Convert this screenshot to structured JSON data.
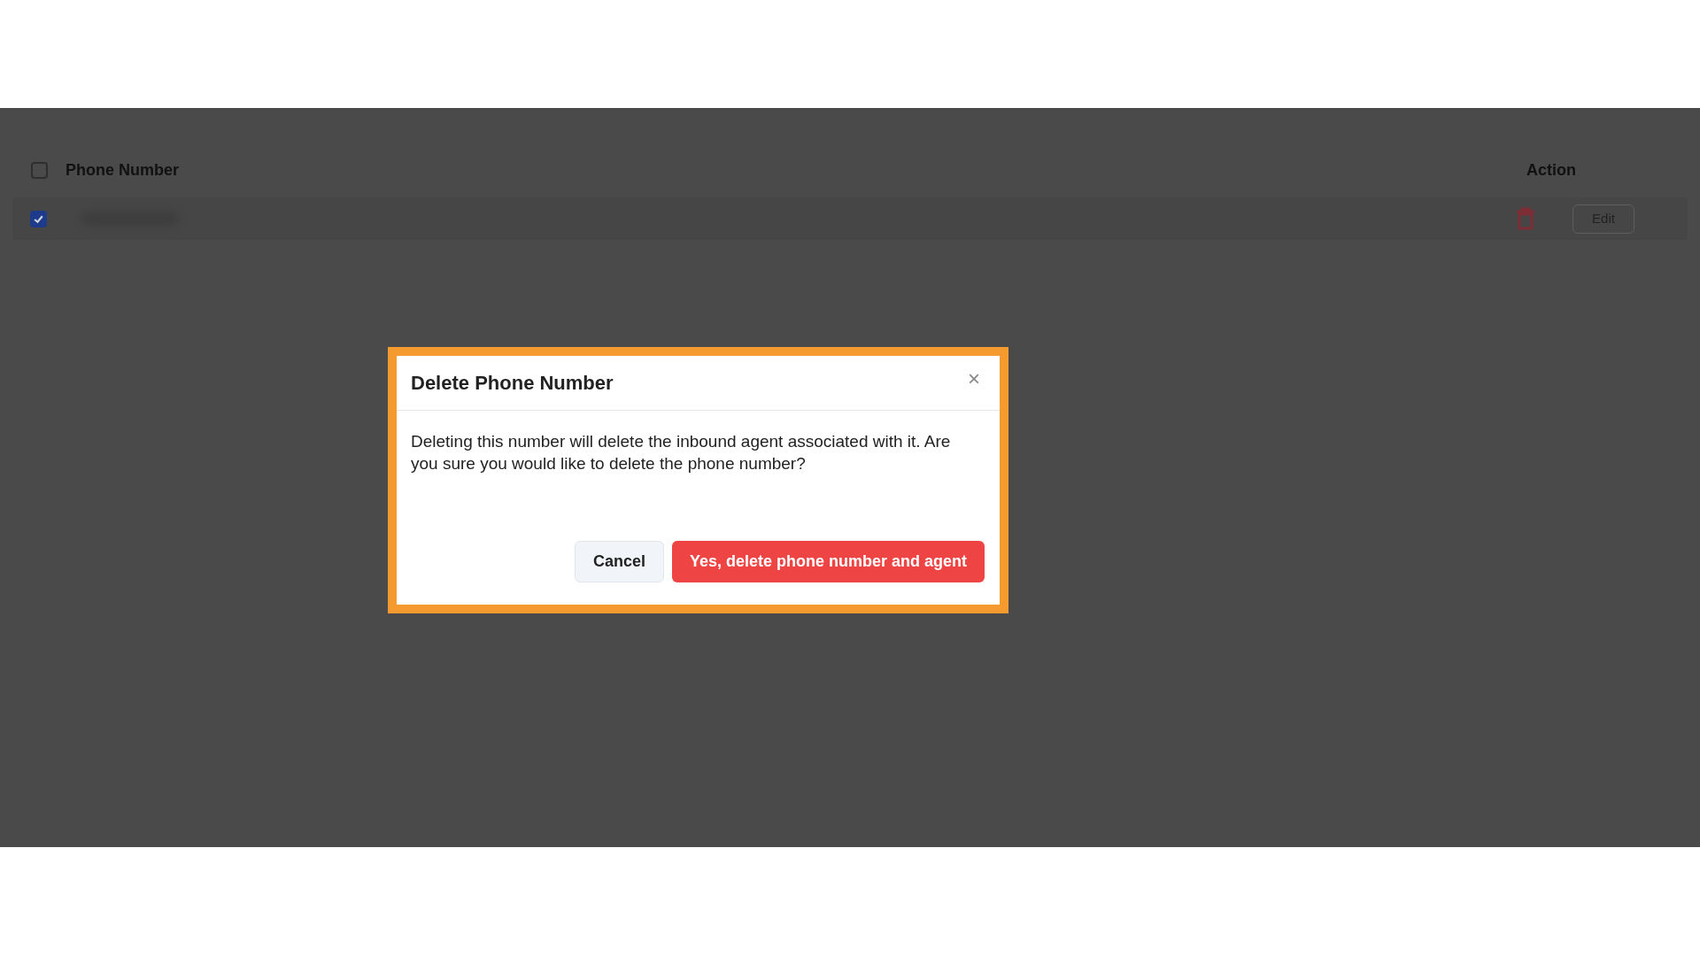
{
  "table": {
    "select_all": {
      "checked": false
    },
    "columns": [
      "Phone Number",
      "Action"
    ],
    "rows": [
      {
        "checked": true,
        "action_button": "Edit"
      }
    ]
  },
  "dialog": {
    "title": "Delete Phone Number",
    "close": "×",
    "message": "Deleting this number will delete the inbound agent associated with it. Are you sure you would like to delete the phone number?",
    "buttons": [
      {
        "label": "Cancel",
        "kind": "secondary"
      },
      {
        "label": "Yes, delete phone number and agent",
        "kind": "danger"
      }
    ]
  }
}
